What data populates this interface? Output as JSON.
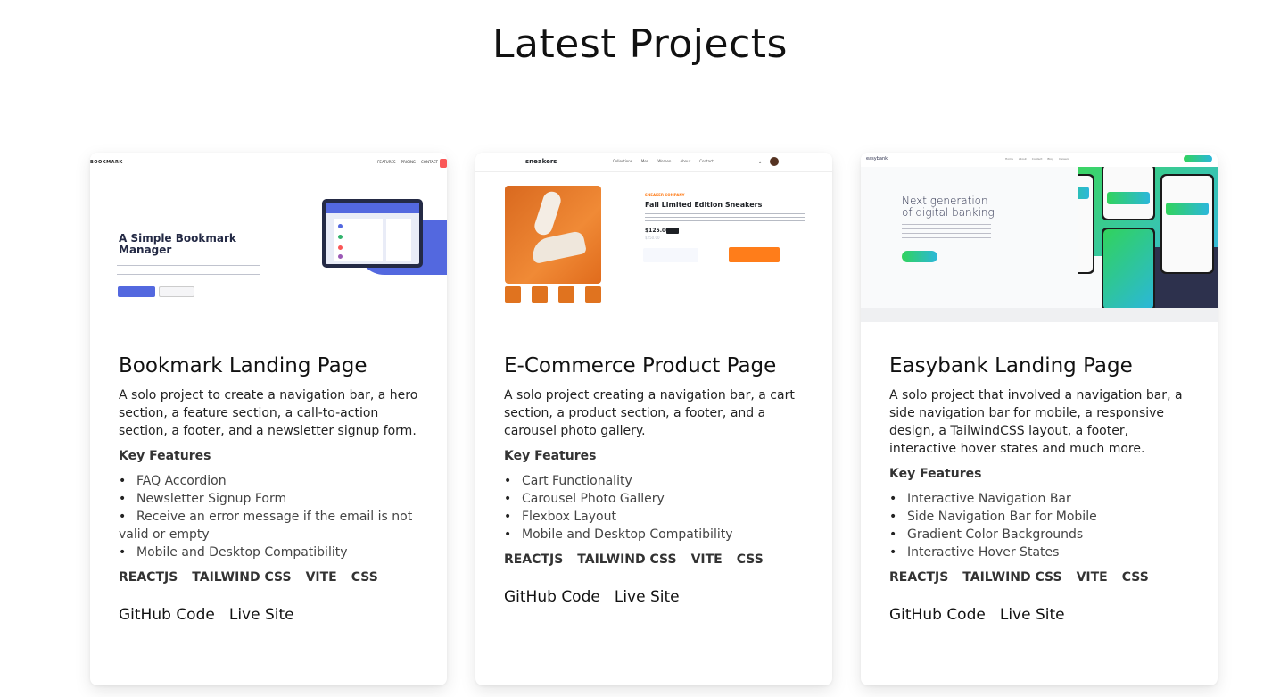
{
  "page": {
    "title": "Latest Projects"
  },
  "projects": [
    {
      "title": "Bookmark Landing Page",
      "description": "A solo project to create a navigation bar, a hero section, a feature section, a call-to-action section, a footer, and a newsletter signup form.",
      "features_heading": "Key Features",
      "features": [
        "FAQ Accordion",
        "Newsletter Signup Form",
        "Receive an error message if the email is not valid or empty",
        "Mobile and Desktop Compatibility"
      ],
      "tags": [
        "REACTJS",
        "TAILWIND CSS",
        "VITE",
        "CSS"
      ],
      "github_label": "GitHub Code",
      "live_label": "Live Site",
      "preview": {
        "logo": "BOOKMARK",
        "nav": [
          "FEATURES",
          "PRICING",
          "CONTACT"
        ],
        "heading": "A Simple Bookmark Manager"
      }
    },
    {
      "title": "E-Commerce Product Page",
      "description": "A solo project creating a navigation bar, a cart section, a product section, a footer, and a carousel photo gallery.",
      "features_heading": "Key Features",
      "features": [
        "Cart Functionality",
        "Carousel Photo Gallery",
        "Flexbox Layout",
        "Mobile and Desktop Compatibility"
      ],
      "tags": [
        "REACTJS",
        "TAILWIND CSS",
        "VITE",
        "CSS"
      ],
      "github_label": "GitHub Code",
      "live_label": "Live Site",
      "preview": {
        "logo": "sneakers",
        "nav": [
          "Collections",
          "Men",
          "Women",
          "About",
          "Contact"
        ],
        "company": "SNEAKER COMPANY",
        "heading": "Fall Limited Edition Sneakers",
        "price": "$125.00",
        "old_price": "$250.00"
      }
    },
    {
      "title": "Easybank Landing Page",
      "description": "A solo project that involved a navigation bar, a side navigation bar for mobile, a responsive design, a TailwindCSS layout, a footer, interactive hover states and much more.",
      "features_heading": "Key Features",
      "features": [
        "Interactive Navigation Bar",
        "Side Navigation Bar for Mobile",
        "Gradient Color Backgrounds",
        "Interactive Hover States"
      ],
      "tags": [
        "REACTJS",
        "TAILWIND CSS",
        "VITE",
        "CSS"
      ],
      "github_label": "GitHub Code",
      "live_label": "Live Site",
      "preview": {
        "logo": "easybank",
        "heading_line1": "Next generation",
        "heading_line2": "of digital banking"
      }
    }
  ]
}
